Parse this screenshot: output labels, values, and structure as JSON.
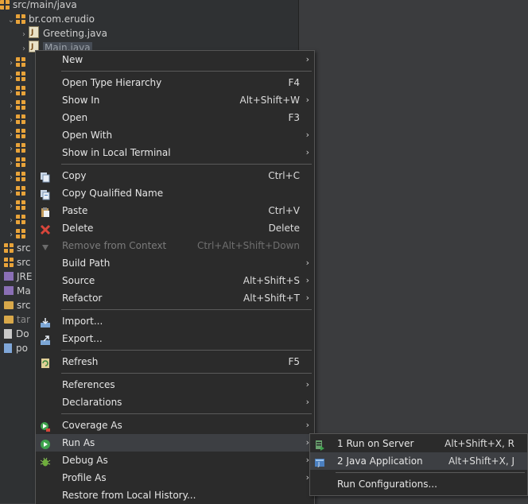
{
  "explorer": {
    "src_main_java": "src/main/java",
    "package": "br.com.erudio",
    "file_greeting": "Greeting.java",
    "file_main": "Main.java",
    "collapsed_labels": [
      "src",
      "src",
      "JRE",
      "Ma",
      "src",
      "tar",
      "Do",
      "po"
    ]
  },
  "menu": {
    "items": [
      {
        "label": "New",
        "shortcut": "",
        "submenu": true
      },
      {
        "label": "Open Type Hierarchy",
        "shortcut": "F4",
        "submenu": false
      },
      {
        "label": "Show In",
        "shortcut": "Alt+Shift+W",
        "submenu": true
      },
      {
        "label": "Open",
        "shortcut": "F3",
        "submenu": false
      },
      {
        "label": "Open With",
        "shortcut": "",
        "submenu": true
      },
      {
        "label": "Show in Local Terminal",
        "shortcut": "",
        "submenu": true
      },
      {
        "label": "Copy",
        "shortcut": "Ctrl+C",
        "submenu": false
      },
      {
        "label": "Copy Qualified Name",
        "shortcut": "",
        "submenu": false
      },
      {
        "label": "Paste",
        "shortcut": "Ctrl+V",
        "submenu": false
      },
      {
        "label": "Delete",
        "shortcut": "Delete",
        "submenu": false
      },
      {
        "label": "Remove from Context",
        "shortcut": "Ctrl+Alt+Shift+Down",
        "submenu": false
      },
      {
        "label": "Build Path",
        "shortcut": "",
        "submenu": true
      },
      {
        "label": "Source",
        "shortcut": "Alt+Shift+S",
        "submenu": true
      },
      {
        "label": "Refactor",
        "shortcut": "Alt+Shift+T",
        "submenu": true
      },
      {
        "label": "Import...",
        "shortcut": "",
        "submenu": false
      },
      {
        "label": "Export...",
        "shortcut": "",
        "submenu": false
      },
      {
        "label": "Refresh",
        "shortcut": "F5",
        "submenu": false
      },
      {
        "label": "References",
        "shortcut": "",
        "submenu": true
      },
      {
        "label": "Declarations",
        "shortcut": "",
        "submenu": true
      },
      {
        "label": "Coverage As",
        "shortcut": "",
        "submenu": true
      },
      {
        "label": "Run As",
        "shortcut": "",
        "submenu": true
      },
      {
        "label": "Debug As",
        "shortcut": "",
        "submenu": true
      },
      {
        "label": "Profile As",
        "shortcut": "",
        "submenu": true
      },
      {
        "label": "Restore from Local History...",
        "shortcut": "",
        "submenu": false
      }
    ],
    "submenu_arrow": "›"
  },
  "run_as_submenu": {
    "items": [
      {
        "label": "1 Run on Server",
        "shortcut": "Alt+Shift+X, R"
      },
      {
        "label": "2 Java Application",
        "shortcut": "Alt+Shift+X, J"
      },
      {
        "label": "Run Configurations...",
        "shortcut": ""
      }
    ]
  },
  "icons": {
    "copy": "copy-icon",
    "copy_qualified": "copy-qualified-name-icon",
    "paste": "paste-icon",
    "delete": "delete-icon",
    "remove_context": "remove-context-icon",
    "import": "import-icon",
    "export": "export-icon",
    "refresh": "refresh-icon",
    "coverage": "coverage-icon",
    "run": "run-icon",
    "debug": "debug-icon",
    "server": "server-icon",
    "java_app": "java-application-icon"
  },
  "colors": {
    "delete_red": "#d9463b",
    "run_green": "#3fa34d",
    "accent": "#e8a33a"
  }
}
